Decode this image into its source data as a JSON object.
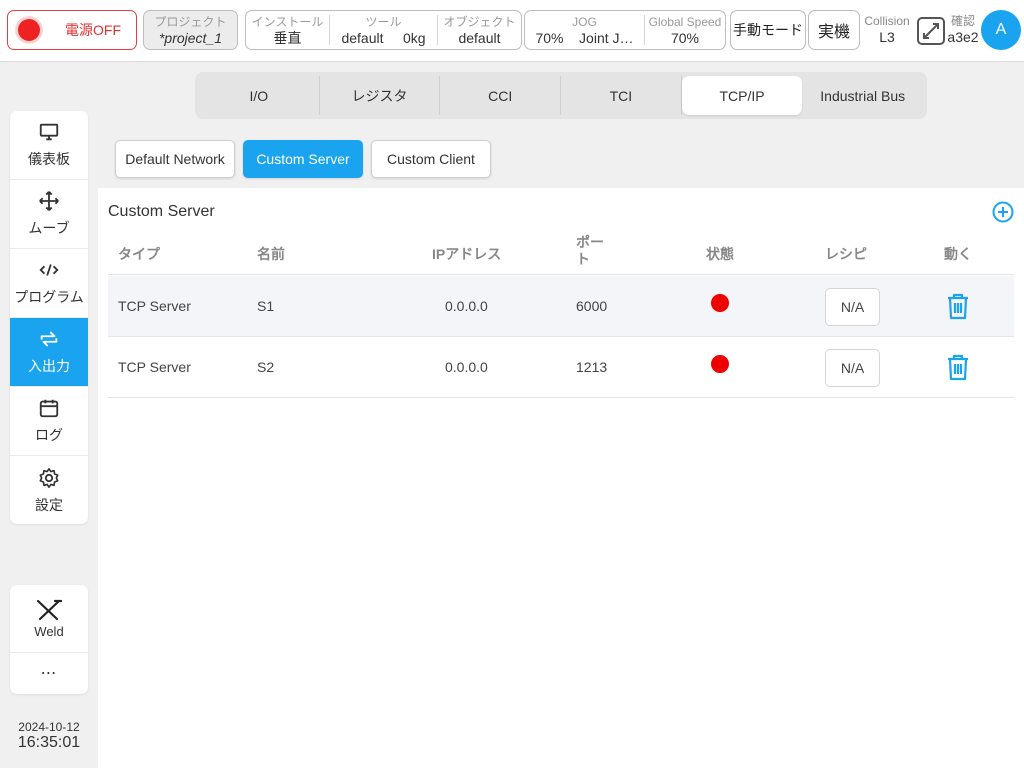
{
  "topbar": {
    "power_label": "電源OFF",
    "project": {
      "caption": "プロジェクト",
      "value": "*project_1"
    },
    "install": {
      "installation": {
        "caption": "インストール",
        "value": "垂直"
      },
      "tool": {
        "caption": "ツール",
        "value": "default     0kg"
      },
      "object": {
        "caption": "オブジェクト",
        "value": "default"
      }
    },
    "motion": {
      "jog": {
        "caption": "JOG",
        "value": "70%    Joint J…"
      },
      "speed": {
        "caption": "Global Speed",
        "value": "70%"
      }
    },
    "manual_mode_label": "手動モード",
    "real_label": "実機",
    "collision": {
      "caption": "Collision",
      "value": "L3"
    },
    "confirm": {
      "caption": "確認",
      "value": "a3e2"
    },
    "avatar_letter": "A"
  },
  "sidebar": {
    "items": [
      {
        "label": "儀表板",
        "icon": "monitor-icon"
      },
      {
        "label": "ムーブ",
        "icon": "move-icon"
      },
      {
        "label": "プログラム",
        "icon": "code-icon"
      },
      {
        "label": "入出力",
        "icon": "swap-icon"
      },
      {
        "label": "ログ",
        "icon": "calendar-icon"
      },
      {
        "label": "設定",
        "icon": "gear-icon"
      }
    ],
    "weld_label": "Weld",
    "more_label": "⋯",
    "date": "2024-10-12",
    "time": "16:35:01"
  },
  "tabs": [
    "I/O",
    "レジスタ",
    "CCI",
    "TCI",
    "TCP/IP",
    "Industrial Bus"
  ],
  "active_tab": "TCP/IP",
  "subtabs": [
    "Default Network",
    "Custom Server",
    "Custom Client"
  ],
  "active_subtab": "Custom Server",
  "panel": {
    "title": "Custom Server",
    "columns": {
      "type": "タイプ",
      "name": "名前",
      "ip": "IPアドレス",
      "port": "ポー\nト",
      "status": "状態",
      "recipe": "レシピ",
      "action": "動く"
    },
    "rows": [
      {
        "type": "TCP Server",
        "name": "S1",
        "ip": "0.0.0.0",
        "port": "6000",
        "status": "red",
        "recipe": "N/A"
      },
      {
        "type": "TCP Server",
        "name": "S2",
        "ip": "0.0.0.0",
        "port": "1213",
        "status": "red",
        "recipe": "N/A"
      }
    ]
  },
  "colors": {
    "accent": "#1aa3ee",
    "power": "#e03030",
    "status_red": "#ee0000"
  }
}
